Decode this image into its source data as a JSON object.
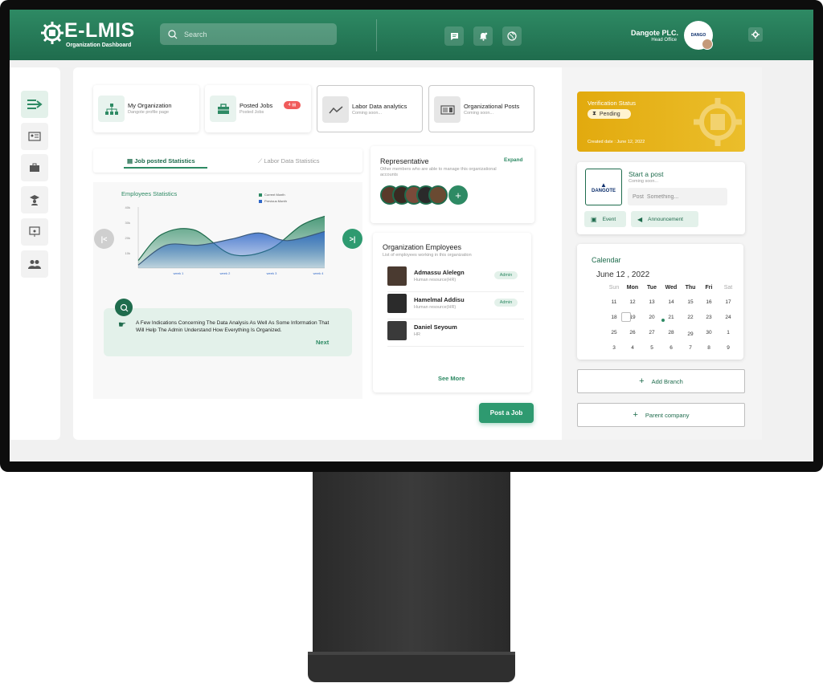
{
  "app": {
    "logo_text": "E-LMIS",
    "logo_subtitle": "Organization Dashboard"
  },
  "header": {
    "search_placeholder": "Search",
    "org_name": "Dangote PLC.",
    "org_office": "Head Office",
    "avatar_text": "DANGO"
  },
  "stat_cards": [
    {
      "title": "My Organization",
      "subtitle": "Dangote profile page"
    },
    {
      "title": "Posted Jobs",
      "subtitle": "Posted Jobs",
      "badge": "4"
    },
    {
      "title": "Labor Data analytics",
      "subtitle": "Coming soon..."
    },
    {
      "title": "Organizational  Posts",
      "subtitle": "Coming soon..."
    }
  ],
  "tabs": {
    "job_stats": "Job posted Statistics",
    "labor_stats": "Labor Data Statistics"
  },
  "chart_data": {
    "type": "area",
    "title": "Employees Statistics",
    "categories": [
      "week 1",
      "week 2",
      "week 3",
      "week 4"
    ],
    "y_ticks": [
      "10k",
      "20k",
      "30k",
      "40k"
    ],
    "ylim": [
      0,
      40
    ],
    "series": [
      {
        "name": "Current Month",
        "color": "#2e8a64",
        "x": [
          0,
          0.5,
          1.2,
          2.0,
          2.8,
          3.5,
          4.0
        ],
        "values": [
          5,
          22,
          25,
          9,
          12,
          28,
          34
        ]
      },
      {
        "name": "Previous Month",
        "color": "#2f67c8",
        "x": [
          0,
          0.6,
          1.3,
          2.0,
          2.6,
          3.2,
          4.0
        ],
        "values": [
          2,
          15,
          15,
          19,
          23,
          18,
          24
        ]
      }
    ],
    "grid": false,
    "legend": "top-right"
  },
  "info": {
    "text": "A Few Indications Concerning The Data Analysis As Well As Some Information That Will Help The Admin Understand How Everything Is Organized.",
    "next": "Next"
  },
  "representative": {
    "title": "Representative",
    "subtitle": "Other members who are able to manage this organizational accounts",
    "expand": "Expand",
    "add": "+"
  },
  "employees": {
    "title": "Organization Employees",
    "subtitle": "List of employees working in this organization",
    "rows": [
      {
        "name": "Admassu Alelegn",
        "role": "Human resource(HR)",
        "badge": "Admin"
      },
      {
        "name": "Hamelmal Addisu",
        "role": "Human resource(HR)",
        "badge": "Admin"
      },
      {
        "name": "Daniel Seyoum",
        "role": "HR",
        "badge": ""
      }
    ],
    "see_more": "See More"
  },
  "post_job": "Post a Job",
  "verification": {
    "title": "Verification Status",
    "status": "Pending",
    "date": "Created date : June 12, 2022"
  },
  "start_post": {
    "logo_text": "DANGOTE",
    "title": "Start a post",
    "subtitle": "Coming soon...",
    "placeholder": "Post  Something...",
    "event": "Event",
    "announcement": "Announcement"
  },
  "calendar": {
    "title": "Calendar",
    "month": "June 12 , 2022",
    "days": [
      "Sun",
      "Mon",
      "Tue",
      "Wed",
      "Thu",
      "Fri",
      "Sat"
    ],
    "weeks": [
      [
        "11",
        "12",
        "13",
        "14",
        "15",
        "16",
        "17"
      ],
      [
        "18",
        "19",
        "20",
        "21",
        "22",
        "23",
        "24"
      ],
      [
        "25",
        "26",
        "27",
        "28",
        "29",
        "30",
        "1",
        "2"
      ],
      [
        "3",
        "4",
        "5",
        "6",
        "7",
        "8",
        "9"
      ]
    ]
  },
  "buttons": {
    "add_branch": "Add Branch",
    "parent_company": "Parent company"
  },
  "colors": {
    "primary": "#2e8a64",
    "header_dark": "#1f6c4d",
    "verify_gold": "#e2aa0e",
    "badge_red": "#f05b5b",
    "chart_blue": "#2f67c8"
  }
}
